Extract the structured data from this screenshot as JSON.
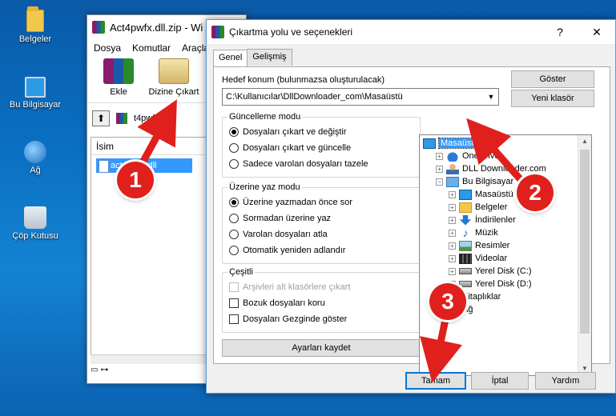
{
  "desktop": {
    "icons": [
      {
        "label": "Belgeler",
        "icon": "folder-icon"
      },
      {
        "label": "Bu Bilgisayar",
        "icon": "computer-icon"
      },
      {
        "label": "Ağ",
        "icon": "network-icon"
      },
      {
        "label": "Çöp Kutusu",
        "icon": "recycle-bin-icon"
      }
    ]
  },
  "rar_window": {
    "title": "Act4pwfx.dll.zip - Wi",
    "menu": [
      "Dosya",
      "Komutlar",
      "Araçla"
    ],
    "toolbar": {
      "add": "Ekle",
      "extract": "Dizine Çıkart"
    },
    "path": "t4pwfx.dl",
    "list_header": "İsim",
    "file_name": "act4pwfx.dll"
  },
  "dialog": {
    "title": "Çıkartma yolu ve seçenekleri",
    "help_glyph": "?",
    "close_glyph": "✕",
    "tabs": [
      "Genel",
      "Gelişmiş"
    ],
    "destination_label": "Hedef konum (bulunmazsa oluşturulacak)",
    "destination_value": "C:\\Kullanıcılar\\DllDownloader_com\\Masaüstü",
    "show_button": "Göster",
    "new_folder_button": "Yeni klasör",
    "update_mode": {
      "title": "Güncelleme modu",
      "options": [
        "Dosyaları çıkart ve değiştir",
        "Dosyaları çıkart ve güncelle",
        "Sadece varolan dosyaları tazele"
      ],
      "selected": 0
    },
    "overwrite_mode": {
      "title": "Üzerine yaz modu",
      "options": [
        "Üzerine yazmadan önce sor",
        "Sormadan üzerine yaz",
        "Varolan dosyaları atla",
        "Otomatik yeniden adlandır"
      ],
      "selected": 0
    },
    "misc": {
      "title": "Çeşitli",
      "options": [
        {
          "label": "Arşivleri alt klasörlere çıkart",
          "checked": false,
          "disabled": true
        },
        {
          "label": "Bozuk dosyaları koru",
          "checked": false,
          "disabled": false
        },
        {
          "label": "Dosyaları Gezginde göster",
          "checked": false,
          "disabled": false
        }
      ]
    },
    "save_settings_button": "Ayarları kaydet",
    "tree": [
      {
        "label": "Masaüstü",
        "level": 0,
        "icon": "desktop-icon",
        "expander": "",
        "selected": true
      },
      {
        "label": "OneDrive",
        "level": 1,
        "icon": "cloud-icon",
        "expander": "+"
      },
      {
        "label": "DLL Downloader.com",
        "level": 1,
        "icon": "user-icon",
        "expander": "+"
      },
      {
        "label": "Bu Bilgisayar",
        "level": 1,
        "icon": "computer-icon",
        "expander": "−"
      },
      {
        "label": "Masaüstü",
        "level": 2,
        "icon": "desktop-icon",
        "expander": "+"
      },
      {
        "label": "Belgeler",
        "level": 2,
        "icon": "folder-icon",
        "expander": "+"
      },
      {
        "label": "İndirilenler",
        "level": 2,
        "icon": "download-icon",
        "expander": "+"
      },
      {
        "label": "Müzik",
        "level": 2,
        "icon": "music-icon",
        "expander": "+"
      },
      {
        "label": "Resimler",
        "level": 2,
        "icon": "pictures-icon",
        "expander": "+"
      },
      {
        "label": "Videolar",
        "level": 2,
        "icon": "videos-icon",
        "expander": "+"
      },
      {
        "label": "Yerel Disk (C:)",
        "level": 2,
        "icon": "disk-icon",
        "expander": "+"
      },
      {
        "label": "Yerel Disk (D:)",
        "level": 2,
        "icon": "disk-icon",
        "expander": "+"
      },
      {
        "label": "Kitaplıklar",
        "level": 1,
        "icon": "library-icon",
        "expander": "+"
      },
      {
        "label": "Ağ",
        "level": 1,
        "icon": "network-icon",
        "expander": "+"
      }
    ],
    "ok_button": "Tamam",
    "cancel_button": "İptal",
    "help_button": "Yardım"
  },
  "callouts": [
    "1",
    "2",
    "3"
  ],
  "colors": {
    "callout": "#e0201c",
    "selection": "#3399ff",
    "focus_border": "#0078d7"
  }
}
